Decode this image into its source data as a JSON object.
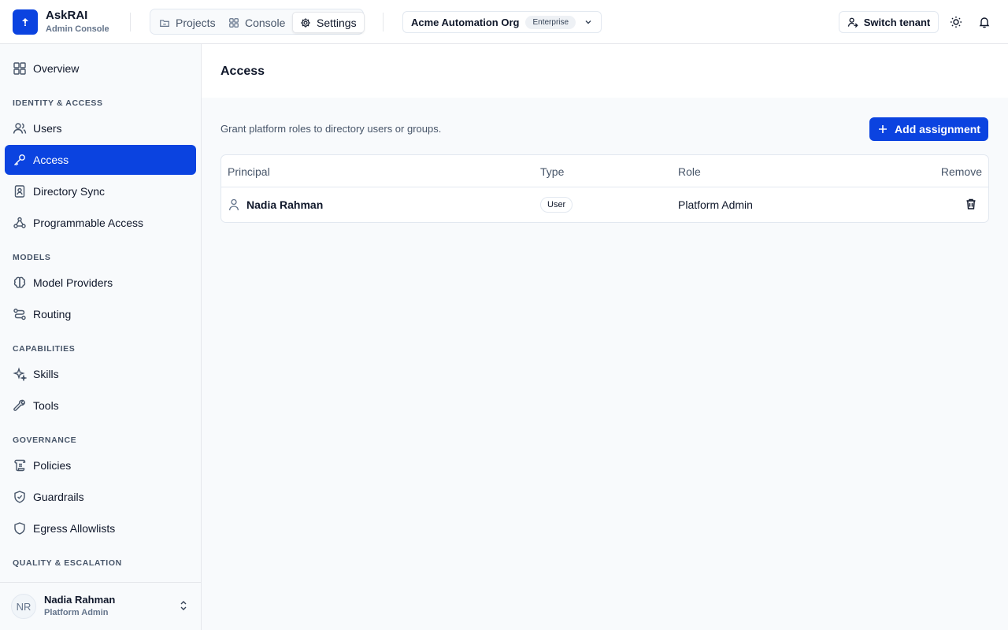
{
  "brand": {
    "name": "AskRAI",
    "subtitle": "Admin Console"
  },
  "header": {
    "tabs": [
      {
        "label": "Projects",
        "icon": "folder-icon"
      },
      {
        "label": "Console",
        "icon": "grid-icon"
      },
      {
        "label": "Settings",
        "icon": "gear-icon",
        "active": true
      }
    ],
    "org": {
      "name": "Acme Automation Org",
      "badge": "Enterprise"
    },
    "switch_tenant_label": "Switch tenant"
  },
  "sidebar": {
    "overview": "Overview",
    "sections": [
      {
        "label": "IDENTITY & ACCESS",
        "items": [
          "Users",
          "Access",
          "Directory Sync",
          "Programmable Access"
        ]
      },
      {
        "label": "MODELS",
        "items": [
          "Model Providers",
          "Routing"
        ]
      },
      {
        "label": "CAPABILITIES",
        "items": [
          "Skills",
          "Tools"
        ]
      },
      {
        "label": "GOVERNANCE",
        "items": [
          "Policies",
          "Guardrails",
          "Egress Allowlists"
        ]
      },
      {
        "label": "QUALITY & ESCALATION",
        "items": []
      }
    ],
    "active_item": "Access",
    "user": {
      "initials": "NR",
      "name": "Nadia Rahman",
      "role": "Platform Admin"
    }
  },
  "main": {
    "title": "Access",
    "description": "Grant platform roles to directory users or groups.",
    "add_button": "Add assignment",
    "table": {
      "columns": [
        "Principal",
        "Type",
        "Role",
        "Remove"
      ],
      "rows": [
        {
          "principal": "Nadia Rahman",
          "type": "User",
          "role": "Platform Admin"
        }
      ]
    }
  },
  "colors": {
    "accent": "#0b43e0",
    "sidebar_bg": "#f8fafc",
    "border": "#e5e7eb"
  }
}
